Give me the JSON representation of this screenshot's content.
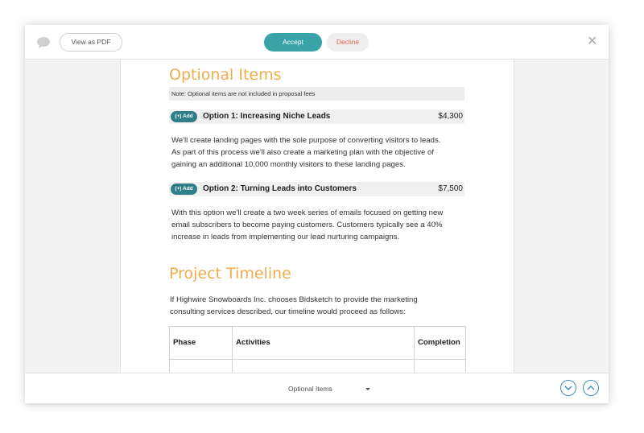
{
  "toolbar": {
    "chat_icon": "chat-bubble-icon",
    "view_pdf_label": "View as PDF",
    "accept_label": "Accept",
    "decline_label": "Decline",
    "close_symbol": "✕",
    "colors": {
      "accept": "#3aa3a8",
      "decline_text": "#e0634f",
      "accent": "#f0ad4e",
      "pill": "#2f7f89"
    }
  },
  "document": {
    "optional_items": {
      "heading": "Optional Items",
      "note": "Note: Optional items are not included in proposal fees",
      "options": [
        {
          "add_label": "(+) Add",
          "title": "Option 1: Increasing Niche Leads",
          "price": "$4,300",
          "description_lines": [
            "We'll create landing pages with the sole purpose of converting visitors to leads.",
            "As part of this process we'll also create a marketing plan with the objective of",
            "gaining an additional 10,000 monthly visitors to these landing pages."
          ]
        },
        {
          "add_label": "(+) Add",
          "title": "Option 2: Turning Leads into Customers",
          "price": "$7,500",
          "description_lines": [
            "With this option we'll create a two week series of emails focused on getting new",
            "email subscribers to become paying customers. Customers typically see a 40%",
            "increase in leads from implementing our lead nurturing campaigns."
          ]
        }
      ]
    },
    "timeline": {
      "heading": "Project Timeline",
      "intro_lines": [
        "If Highwire Snowboards Inc. chooses Bidsketch to provide the marketing",
        "consulting services described, our timeline would proceed as follows:"
      ],
      "columns": [
        "Phase",
        "Activities",
        "Completion"
      ]
    }
  },
  "footer": {
    "section_selected": "Optional Items",
    "nav_down_icon": "chevron-down-icon",
    "nav_up_icon": "chevron-up-icon"
  }
}
